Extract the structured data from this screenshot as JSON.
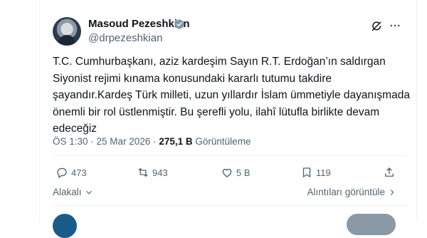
{
  "author": {
    "name": "Masoud Pezeshkian",
    "handle": "@drpezeshkian"
  },
  "tweet": {
    "lines": [
      "T.C. Cumhurbaşkanı, aziz kardeşim Sayın R.T. Erdoğan’ın saldırgan",
      "Siyonist rejimi kınama konusundaki kararlı tutumu takdire",
      "şayandır.Kardeş Türk milleti, uzun yıllardır İslam ümmetiyle dayanışmada",
      "önemli bir rol üstlenmiştir. Bu şerefli yolu, ilahî lütufla birlikte devam",
      "edeceğiz"
    ]
  },
  "meta": {
    "time": "ÖS 1:30",
    "separator": " · ",
    "date": "25 Mar 2026",
    "views_count": "275,1 B",
    "views_label": "Görüntüleme"
  },
  "actions": {
    "replies": "473",
    "reposts": "943",
    "likes": "5 B",
    "bookmarks": "119"
  },
  "links": {
    "related": "Alakalı",
    "quotes": "Alıntıları görüntüle"
  },
  "icons": {
    "verified": "verified-badge-icon",
    "grok": "grok-icon",
    "more": "more-icon",
    "reply": "reply-icon",
    "repost": "repost-icon",
    "like": "heart-icon",
    "bookmark": "bookmark-icon",
    "share": "share-icon"
  },
  "colors": {
    "text": "#0f1419",
    "secondary": "#536471",
    "divider": "#eff3f4",
    "verified": "#829aab"
  }
}
